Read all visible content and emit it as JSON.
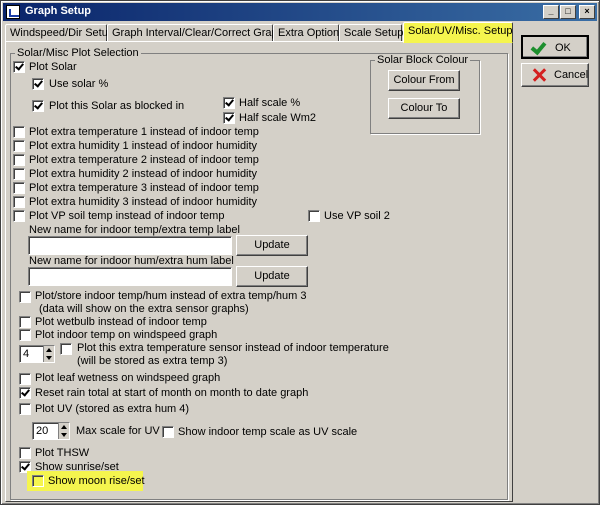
{
  "window": {
    "title": "Graph Setup",
    "minimize_glyph": "_",
    "maximize_glyph": "□",
    "close_glyph": "×"
  },
  "tabs": [
    {
      "label": "Windspeed/Dir Setup"
    },
    {
      "label": "Graph Interval/Clear/Correct Graph"
    },
    {
      "label": "Extra Options"
    },
    {
      "label": "Scale Setup"
    },
    {
      "label": "Solar/UV/Misc. Setup"
    }
  ],
  "buttons": {
    "ok": "OK",
    "cancel": "Cancel"
  },
  "group": {
    "title": "Solar/Misc Plot Selection"
  },
  "solar_block": {
    "title": "Solar Block Colour",
    "colour_from": "Colour From",
    "colour_to": "Colour To"
  },
  "options": {
    "plot_solar": {
      "label": "Plot Solar",
      "checked": true
    },
    "use_solar_pct": {
      "label": "Use solar %",
      "checked": true
    },
    "plot_solar_blocked": {
      "label": "Plot this Solar as blocked in",
      "checked": true
    },
    "half_scale_pct": {
      "label": "Half scale %",
      "checked": true
    },
    "half_scale_wm2": {
      "label": "Half scale Wm2",
      "checked": true
    },
    "extra_temp_1": {
      "label": "Plot extra temperature 1 instead of indoor temp",
      "checked": false
    },
    "extra_hum_1": {
      "label": "Plot extra humidity 1 instead of indoor humidity",
      "checked": false
    },
    "extra_temp_2": {
      "label": "Plot extra temperature 2 instead of indoor temp",
      "checked": false
    },
    "extra_hum_2": {
      "label": "Plot extra humidity 2 instead of indoor humidity",
      "checked": false
    },
    "extra_temp_3": {
      "label": "Plot extra temperature 3 instead of indoor temp",
      "checked": false
    },
    "extra_hum_3": {
      "label": "Plot extra humidity 3 instead of indoor humidity",
      "checked": false
    },
    "vp_soil_temp": {
      "label": "Plot VP soil temp instead of indoor temp",
      "checked": false
    },
    "use_vp_soil_2": {
      "label": "Use VP soil 2",
      "checked": false
    },
    "store_indoor": {
      "label": "Plot/store indoor temp/hum instead of extra temp/hum 3",
      "note": "(data will show on the extra sensor graphs)",
      "checked": false
    },
    "wetbulb": {
      "label": "Plot wetbulb instead of indoor temp",
      "checked": false
    },
    "indoor_on_wind": {
      "label": "Plot indoor temp on windspeed graph",
      "checked": false
    },
    "extra_sensor": {
      "label": "Plot this extra temperature sensor instead of indoor temperature",
      "note": "(will be stored as extra temp 3)",
      "checked": false
    },
    "leaf_wetness": {
      "label": "Plot leaf wetness on windspeed graph",
      "checked": false
    },
    "reset_rain": {
      "label": "Reset rain total at start of month on month to date graph",
      "checked": true
    },
    "plot_uv": {
      "label": "Plot UV (stored as extra hum 4)",
      "checked": false
    },
    "indoor_as_uv": {
      "label": "Show indoor temp scale as UV scale",
      "checked": false
    },
    "plot_thsw": {
      "label": "Plot THSW",
      "checked": false
    },
    "sunrise_set": {
      "label": "Show sunrise/set",
      "checked": true
    },
    "moon_rise_set": {
      "label": "Show moon rise/set",
      "checked": false
    }
  },
  "labels": {
    "indoor_temp_name": "New name for indoor temp/extra temp label",
    "indoor_hum_name": "New name for indoor hum/extra hum label",
    "update": "Update",
    "max_uv_scale": "Max scale for UV"
  },
  "inputs": {
    "indoor_temp_name_value": "",
    "indoor_hum_name_value": "",
    "sensor_number": "4",
    "max_uv_value": "20"
  },
  "colors": {
    "highlight": "#f5f54e",
    "titlebar": "#0a246a"
  }
}
